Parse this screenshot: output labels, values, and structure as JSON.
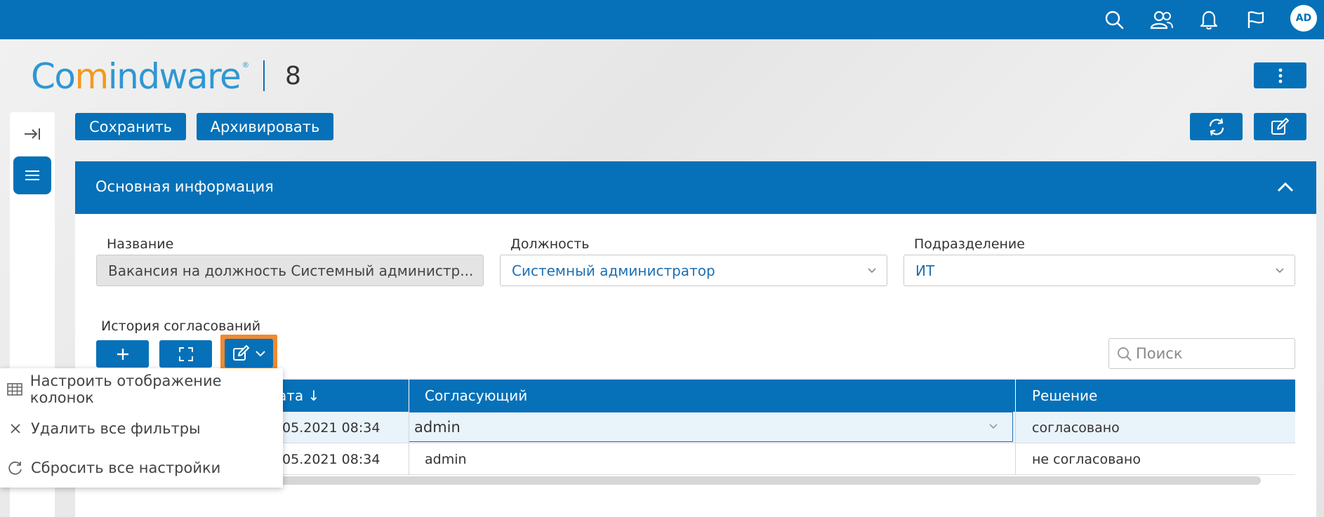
{
  "colors": {
    "primary": "#0671b8",
    "logo_blue": "#2e97d4",
    "logo_orange": "#f29a1f",
    "highlight": "#f28a2e"
  },
  "topbar": {
    "icons": [
      "search-icon",
      "users-icon",
      "bell-icon",
      "flag-icon"
    ],
    "avatar_initials": "AD"
  },
  "header": {
    "logo_parts": [
      "Co",
      "m",
      "indware"
    ],
    "logo_reg": "®",
    "record_number": "8"
  },
  "toolbar": {
    "save_label": "Сохранить",
    "archive_label": "Архивировать"
  },
  "section": {
    "title": "Основная информация"
  },
  "fields": {
    "name_label": "Название",
    "name_value": "Вакансия на должность Системный администр...",
    "position_label": "Должность",
    "position_value": "Системный администратор",
    "department_label": "Подразделение",
    "department_value": "ИТ"
  },
  "history": {
    "title": "История согласований",
    "search_placeholder": "Поиск",
    "columns": [
      "ата ↓",
      "Согласующий",
      "Решение"
    ],
    "rows": [
      {
        "date": ".05.2021 08:34",
        "approver": "admin",
        "decision": "согласовано"
      },
      {
        "date": ".05.2021 08:34",
        "approver": "admin",
        "decision": "не согласовано"
      }
    ]
  },
  "menu": {
    "items": [
      {
        "label": "Настроить отображение колонок",
        "icon": "table-icon"
      },
      {
        "label": "Удалить все фильтры",
        "icon": "close-icon"
      },
      {
        "label": "Сбросить все настройки",
        "icon": "reset-icon"
      }
    ]
  }
}
